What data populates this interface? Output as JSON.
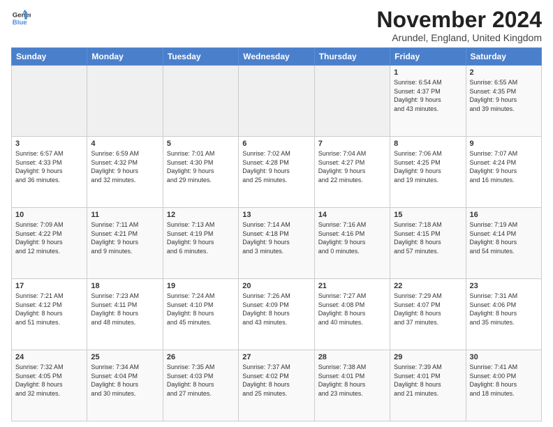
{
  "logo": {
    "line1": "General",
    "line2": "Blue"
  },
  "title": "November 2024",
  "subtitle": "Arundel, England, United Kingdom",
  "days_of_week": [
    "Sunday",
    "Monday",
    "Tuesday",
    "Wednesday",
    "Thursday",
    "Friday",
    "Saturday"
  ],
  "weeks": [
    [
      {
        "day": "",
        "info": ""
      },
      {
        "day": "",
        "info": ""
      },
      {
        "day": "",
        "info": ""
      },
      {
        "day": "",
        "info": ""
      },
      {
        "day": "",
        "info": ""
      },
      {
        "day": "1",
        "info": "Sunrise: 6:54 AM\nSunset: 4:37 PM\nDaylight: 9 hours\nand 43 minutes."
      },
      {
        "day": "2",
        "info": "Sunrise: 6:55 AM\nSunset: 4:35 PM\nDaylight: 9 hours\nand 39 minutes."
      }
    ],
    [
      {
        "day": "3",
        "info": "Sunrise: 6:57 AM\nSunset: 4:33 PM\nDaylight: 9 hours\nand 36 minutes."
      },
      {
        "day": "4",
        "info": "Sunrise: 6:59 AM\nSunset: 4:32 PM\nDaylight: 9 hours\nand 32 minutes."
      },
      {
        "day": "5",
        "info": "Sunrise: 7:01 AM\nSunset: 4:30 PM\nDaylight: 9 hours\nand 29 minutes."
      },
      {
        "day": "6",
        "info": "Sunrise: 7:02 AM\nSunset: 4:28 PM\nDaylight: 9 hours\nand 25 minutes."
      },
      {
        "day": "7",
        "info": "Sunrise: 7:04 AM\nSunset: 4:27 PM\nDaylight: 9 hours\nand 22 minutes."
      },
      {
        "day": "8",
        "info": "Sunrise: 7:06 AM\nSunset: 4:25 PM\nDaylight: 9 hours\nand 19 minutes."
      },
      {
        "day": "9",
        "info": "Sunrise: 7:07 AM\nSunset: 4:24 PM\nDaylight: 9 hours\nand 16 minutes."
      }
    ],
    [
      {
        "day": "10",
        "info": "Sunrise: 7:09 AM\nSunset: 4:22 PM\nDaylight: 9 hours\nand 12 minutes."
      },
      {
        "day": "11",
        "info": "Sunrise: 7:11 AM\nSunset: 4:21 PM\nDaylight: 9 hours\nand 9 minutes."
      },
      {
        "day": "12",
        "info": "Sunrise: 7:13 AM\nSunset: 4:19 PM\nDaylight: 9 hours\nand 6 minutes."
      },
      {
        "day": "13",
        "info": "Sunrise: 7:14 AM\nSunset: 4:18 PM\nDaylight: 9 hours\nand 3 minutes."
      },
      {
        "day": "14",
        "info": "Sunrise: 7:16 AM\nSunset: 4:16 PM\nDaylight: 9 hours\nand 0 minutes."
      },
      {
        "day": "15",
        "info": "Sunrise: 7:18 AM\nSunset: 4:15 PM\nDaylight: 8 hours\nand 57 minutes."
      },
      {
        "day": "16",
        "info": "Sunrise: 7:19 AM\nSunset: 4:14 PM\nDaylight: 8 hours\nand 54 minutes."
      }
    ],
    [
      {
        "day": "17",
        "info": "Sunrise: 7:21 AM\nSunset: 4:12 PM\nDaylight: 8 hours\nand 51 minutes."
      },
      {
        "day": "18",
        "info": "Sunrise: 7:23 AM\nSunset: 4:11 PM\nDaylight: 8 hours\nand 48 minutes."
      },
      {
        "day": "19",
        "info": "Sunrise: 7:24 AM\nSunset: 4:10 PM\nDaylight: 8 hours\nand 45 minutes."
      },
      {
        "day": "20",
        "info": "Sunrise: 7:26 AM\nSunset: 4:09 PM\nDaylight: 8 hours\nand 43 minutes."
      },
      {
        "day": "21",
        "info": "Sunrise: 7:27 AM\nSunset: 4:08 PM\nDaylight: 8 hours\nand 40 minutes."
      },
      {
        "day": "22",
        "info": "Sunrise: 7:29 AM\nSunset: 4:07 PM\nDaylight: 8 hours\nand 37 minutes."
      },
      {
        "day": "23",
        "info": "Sunrise: 7:31 AM\nSunset: 4:06 PM\nDaylight: 8 hours\nand 35 minutes."
      }
    ],
    [
      {
        "day": "24",
        "info": "Sunrise: 7:32 AM\nSunset: 4:05 PM\nDaylight: 8 hours\nand 32 minutes."
      },
      {
        "day": "25",
        "info": "Sunrise: 7:34 AM\nSunset: 4:04 PM\nDaylight: 8 hours\nand 30 minutes."
      },
      {
        "day": "26",
        "info": "Sunrise: 7:35 AM\nSunset: 4:03 PM\nDaylight: 8 hours\nand 27 minutes."
      },
      {
        "day": "27",
        "info": "Sunrise: 7:37 AM\nSunset: 4:02 PM\nDaylight: 8 hours\nand 25 minutes."
      },
      {
        "day": "28",
        "info": "Sunrise: 7:38 AM\nSunset: 4:01 PM\nDaylight: 8 hours\nand 23 minutes."
      },
      {
        "day": "29",
        "info": "Sunrise: 7:39 AM\nSunset: 4:01 PM\nDaylight: 8 hours\nand 21 minutes."
      },
      {
        "day": "30",
        "info": "Sunrise: 7:41 AM\nSunset: 4:00 PM\nDaylight: 8 hours\nand 18 minutes."
      }
    ]
  ]
}
